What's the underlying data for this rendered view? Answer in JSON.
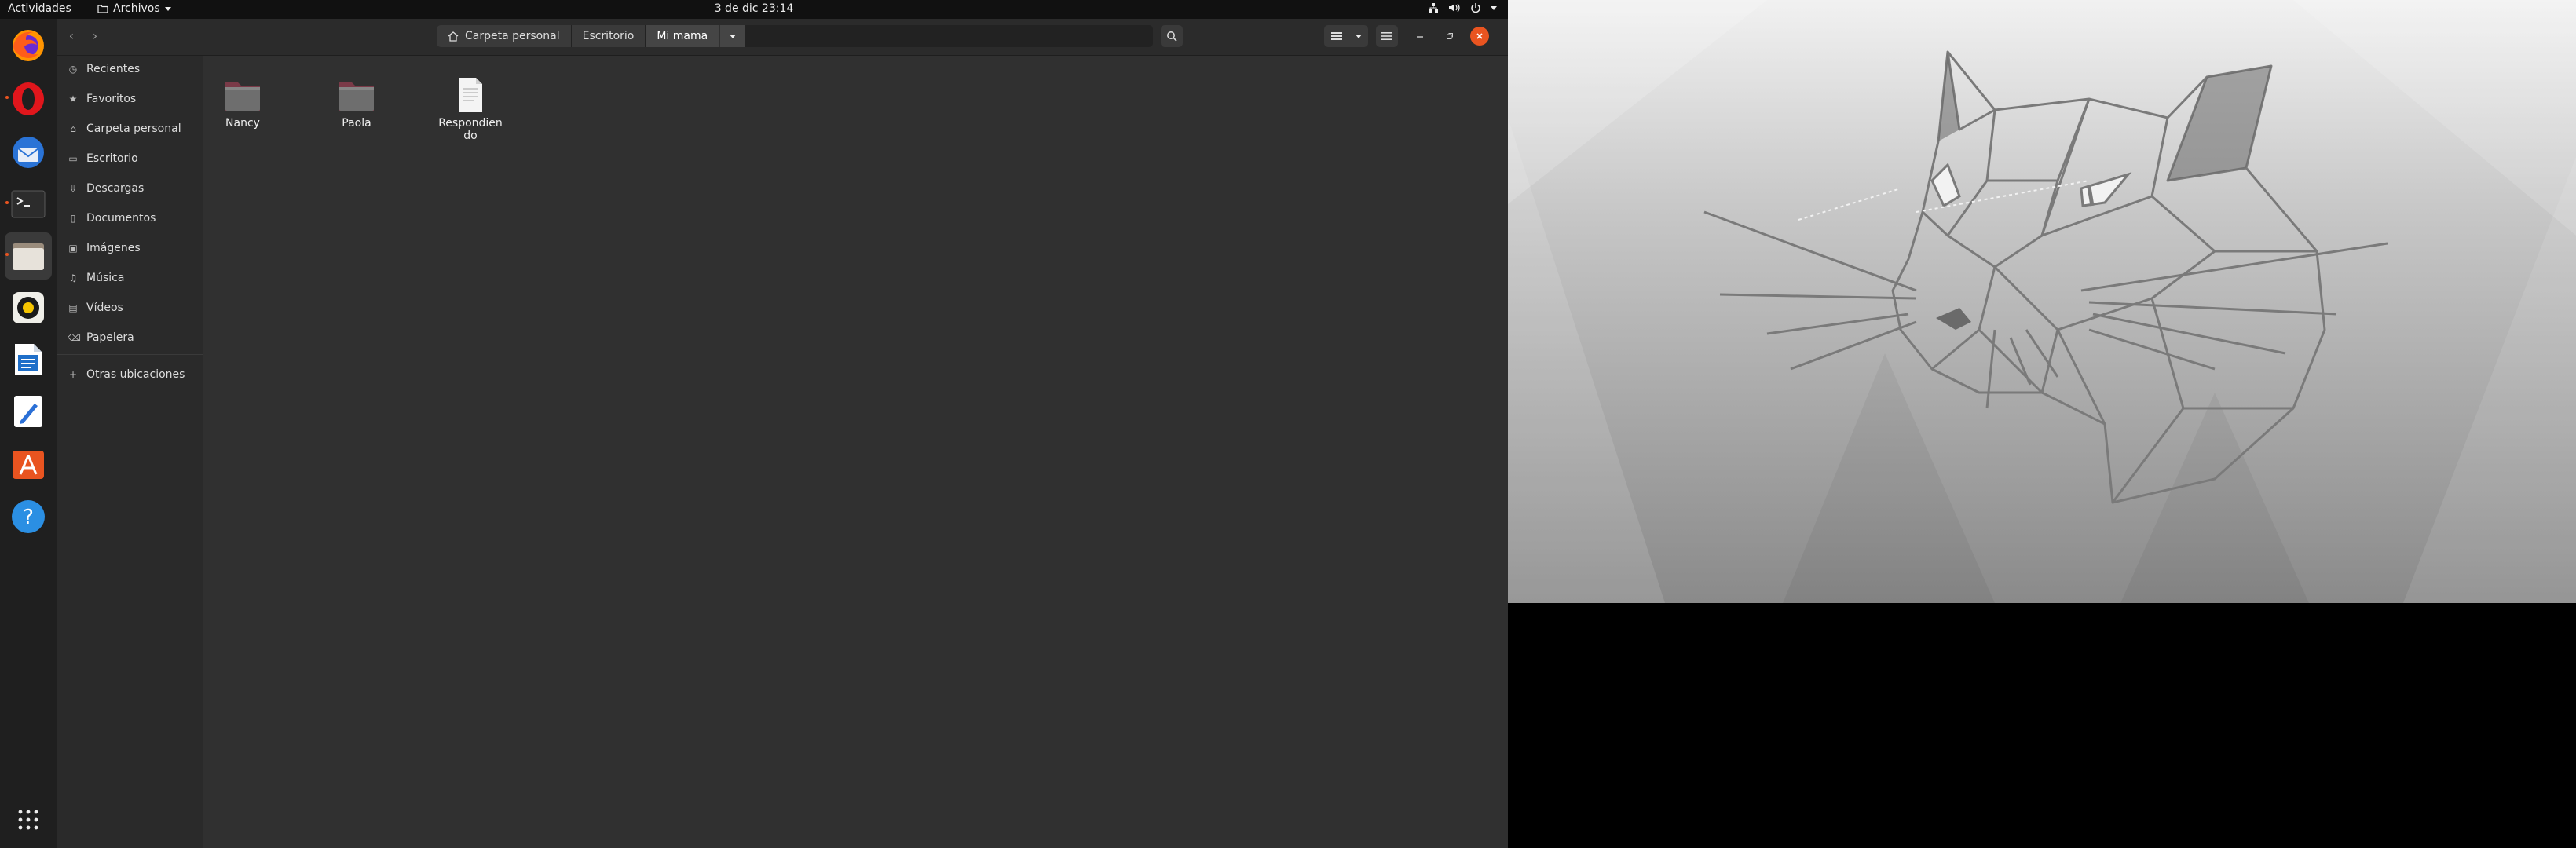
{
  "topbar": {
    "activities": "Actividades",
    "app_menu": "Archivos",
    "clock": "3 de dic  23:14",
    "tray_icons": [
      "network-icon",
      "volume-icon",
      "power-icon"
    ]
  },
  "dock": {
    "apps": [
      "firefox-icon",
      "opera-icon",
      "thunderbird-icon",
      "terminal-icon",
      "files-icon",
      "rhythmbox-icon",
      "writer-icon",
      "text-editor-icon",
      "software-center-icon",
      "help-icon",
      "show-apps-icon"
    ],
    "accent": "#e95420"
  },
  "window": {
    "path": [
      "Carpeta personal",
      "Escritorio",
      "Mi mama"
    ]
  },
  "sidebar": {
    "items": [
      {
        "label": "Recientes",
        "icon": "clock-icon"
      },
      {
        "label": "Favoritos",
        "icon": "star-icon"
      },
      {
        "label": "Carpeta personal",
        "icon": "home-icon"
      },
      {
        "label": "Escritorio",
        "icon": "desktop-icon"
      },
      {
        "label": "Descargas",
        "icon": "download-icon"
      },
      {
        "label": "Documentos",
        "icon": "documents-icon"
      },
      {
        "label": "Imágenes",
        "icon": "pictures-icon"
      },
      {
        "label": "Música",
        "icon": "music-icon"
      },
      {
        "label": "Vídeos",
        "icon": "videos-icon"
      },
      {
        "label": "Papelera",
        "icon": "trash-icon"
      },
      {
        "label": "Otras ubicaciones",
        "icon": "plus-icon"
      }
    ]
  },
  "files": [
    {
      "name": "Nancy",
      "type": "folder"
    },
    {
      "name": "Paola",
      "type": "folder"
    },
    {
      "name": "Respondiendo",
      "type": "document",
      "line1": "Respondien",
      "line2": "do"
    }
  ]
}
